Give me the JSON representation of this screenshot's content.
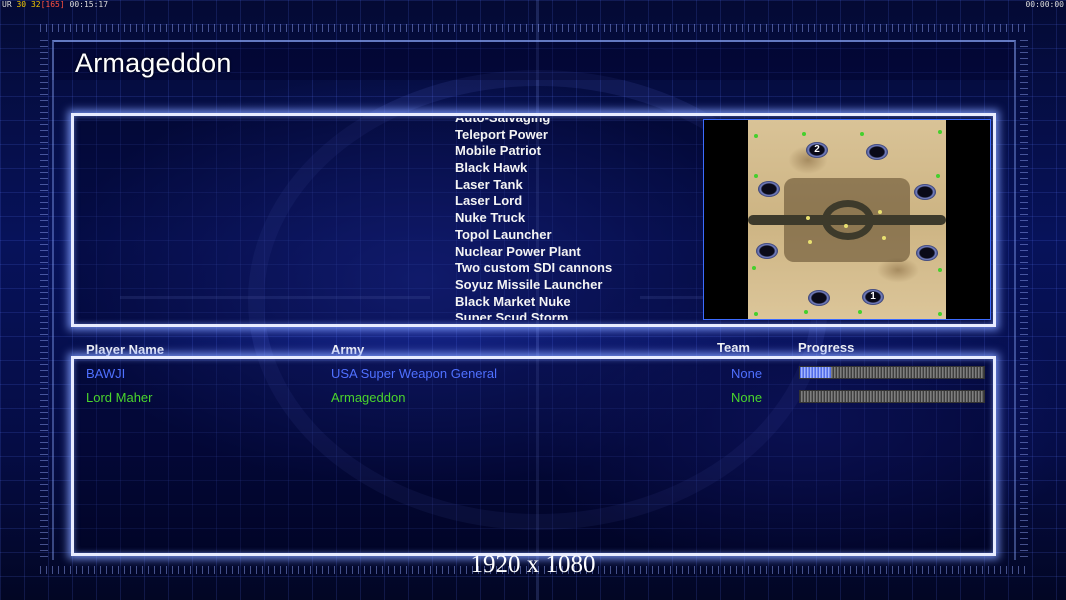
{
  "hud": {
    "fps_prefix": "UR",
    "fps_value": "30",
    "fps_value2": "32",
    "fps_value3": "[165]",
    "elapsed": "00:15:17",
    "clock": "00:00:00"
  },
  "screen": {
    "title": "Armageddon"
  },
  "rules": {
    "partial_top": "Auto-Salvaging",
    "items": [
      "Teleport Power",
      "Mobile Patriot",
      "Black Hawk",
      "Laser Tank",
      "Laser Lord",
      "Nuke Truck",
      "Topol Launcher",
      "Nuclear Power Plant",
      "Two custom SDI cannons",
      "Soyuz Missile Launcher",
      "Black Market Nuke"
    ],
    "partial_bottom": "Super Scud Storm"
  },
  "minimap": {
    "spawn_labels": [
      "2",
      "1"
    ]
  },
  "players": {
    "headers": {
      "name": "Player Name",
      "army": "Army",
      "team": "Team",
      "progress": "Progress"
    },
    "rows": [
      {
        "name": "BAWJI",
        "army": "USA Super Weapon General",
        "team": "None",
        "progress": 0.17,
        "color": "#4f70ff"
      },
      {
        "name": "Lord Maher",
        "army": "Armageddon",
        "team": "None",
        "progress": 0.0,
        "color": "#4ad52c"
      }
    ]
  },
  "footer": {
    "resolution": "1920 x 1080"
  }
}
